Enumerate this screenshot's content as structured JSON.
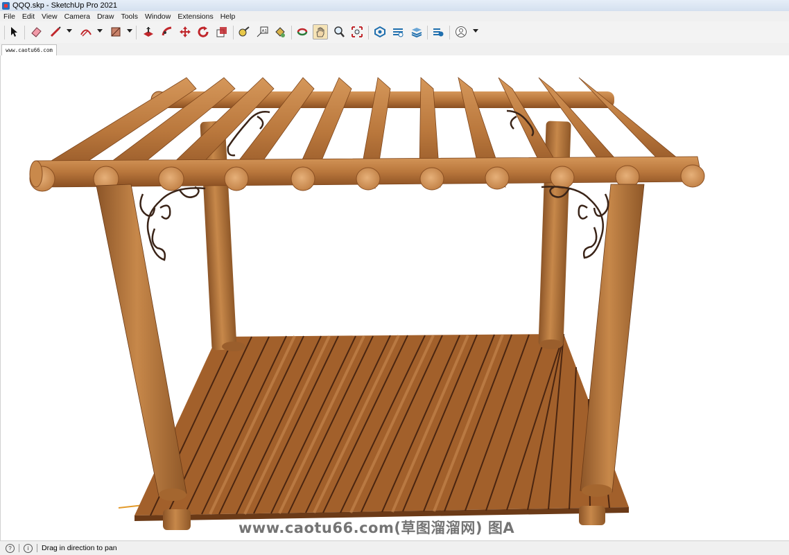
{
  "window": {
    "title": "QQQ.skp - SketchUp Pro 2021"
  },
  "menu": [
    "File",
    "Edit",
    "View",
    "Camera",
    "Draw",
    "Tools",
    "Window",
    "Extensions",
    "Help"
  ],
  "toolbar": {
    "tools": [
      {
        "name": "select-tool-icon"
      },
      {
        "name": "eraser-tool-icon"
      },
      {
        "name": "line-tool-icon"
      },
      {
        "name": "arc-tool-icon"
      },
      {
        "name": "rectangle-tool-icon"
      },
      {
        "name": "push-pull-tool-icon"
      },
      {
        "name": "follow-me-tool-icon"
      },
      {
        "name": "move-tool-icon"
      },
      {
        "name": "rotate-tool-icon"
      },
      {
        "name": "scale-tool-icon"
      },
      {
        "name": "tape-measure-tool-icon"
      },
      {
        "name": "text-tool-icon"
      },
      {
        "name": "paint-bucket-tool-icon"
      },
      {
        "name": "orbit-tool-icon"
      },
      {
        "name": "pan-tool-icon"
      },
      {
        "name": "zoom-tool-icon"
      },
      {
        "name": "zoom-extents-tool-icon"
      },
      {
        "name": "3d-warehouse-icon"
      },
      {
        "name": "extension-warehouse-icon"
      },
      {
        "name": "layout-icon"
      },
      {
        "name": "extension-manager-icon"
      },
      {
        "name": "profile-icon"
      }
    ],
    "active_tool": "pan-tool-icon"
  },
  "tab": {
    "label": "www.caotu66.com"
  },
  "status": {
    "hint": "Drag in direction to pan"
  },
  "watermark": {
    "text": "www.caotu66.com(草图溜溜网) 图A"
  },
  "colors": {
    "wood": "#b9773c",
    "wood_dark": "#8a4f22",
    "iron": "#3a2418",
    "axis_orange": "#e39a2a"
  }
}
